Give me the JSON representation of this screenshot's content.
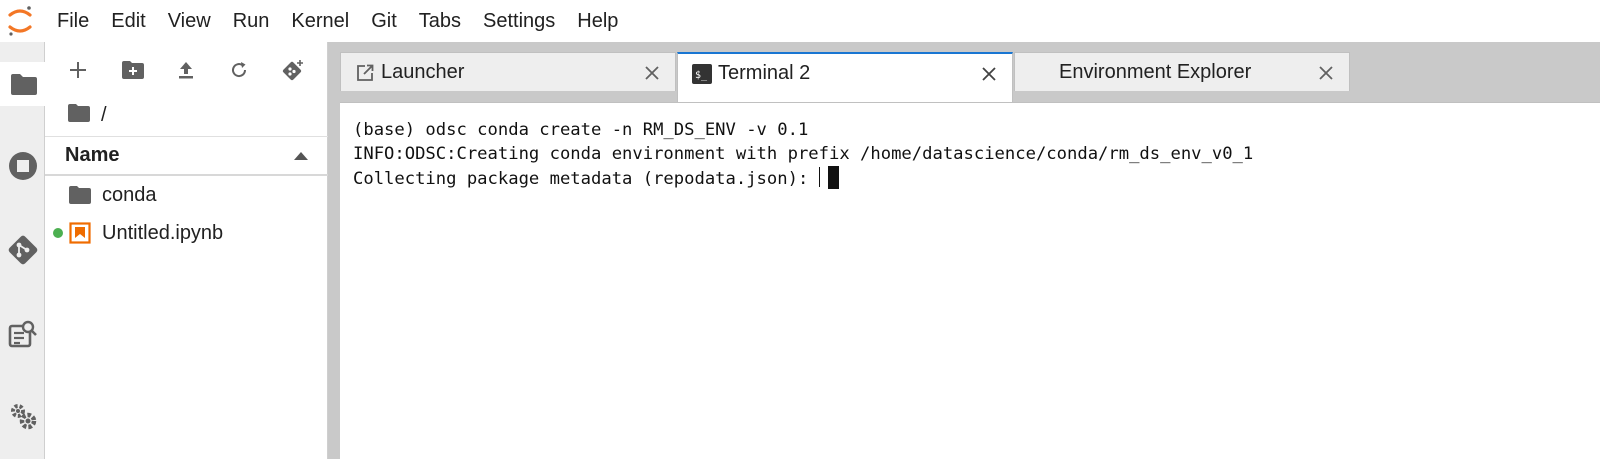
{
  "menu": {
    "items": [
      "File",
      "Edit",
      "View",
      "Run",
      "Kernel",
      "Git",
      "Tabs",
      "Settings",
      "Help"
    ]
  },
  "activity_bar": {
    "icons": [
      "folder-icon",
      "stop-circle-icon",
      "git-icon",
      "property-inspector-icon",
      "extension-settings-icon"
    ]
  },
  "file_browser": {
    "toolbar_icons": [
      "new-launcher-icon",
      "new-folder-icon",
      "upload-icon",
      "refresh-icon",
      "git-clone-icon"
    ],
    "breadcrumb": "/",
    "column_header": "Name",
    "items": [
      {
        "name": "conda",
        "type": "folder",
        "running": false
      },
      {
        "name": "Untitled.ipynb",
        "type": "notebook",
        "running": true
      }
    ]
  },
  "tabs": [
    {
      "label": "Launcher",
      "icon": "launcher-icon",
      "active": false
    },
    {
      "label": "Terminal 2",
      "icon": "terminal-icon",
      "active": true
    },
    {
      "label": "Environment Explorer",
      "icon": "",
      "active": false
    }
  ],
  "terminal": {
    "lines": [
      "(base) odsc conda create -n RM_DS_ENV -v 0.1",
      "INFO:ODSC:Creating conda environment with prefix /home/datascience/conda/rm_ds_env_v0_1",
      "Collecting package metadata (repodata.json): "
    ]
  },
  "colors": {
    "accent": "#1976d2",
    "logo_orange": "#f37726",
    "running_dot": "#4caf50",
    "notebook_orange": "#ef6c00",
    "icon_gray": "#616161"
  }
}
